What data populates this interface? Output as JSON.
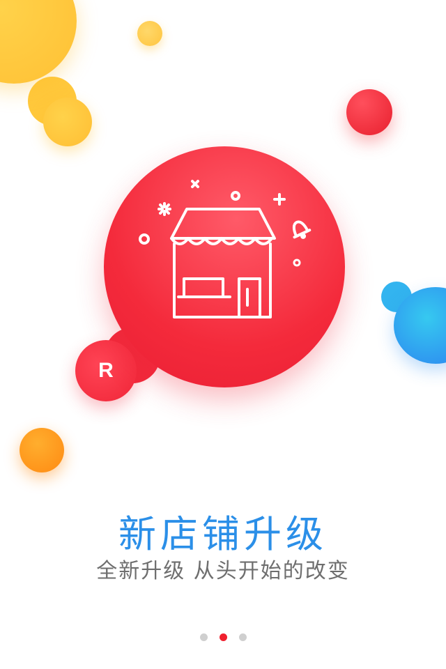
{
  "brand": {
    "logo_letter": "R"
  },
  "onboarding": {
    "title": "新店铺升级",
    "subtitle": "全新升级 从头开始的改变"
  },
  "pager": {
    "total": 3,
    "active_index": 1
  },
  "colors": {
    "title_blue": "#2b8fe8",
    "subtitle_gray": "#6e6e6e",
    "accent_red": "#f0202e",
    "dot_inactive": "#cfcfcf"
  },
  "icons": {
    "main": "store-icon",
    "extras": [
      "sparkle-icon",
      "cross-icon",
      "circle-icon",
      "plus-icon",
      "bell-icon"
    ]
  }
}
